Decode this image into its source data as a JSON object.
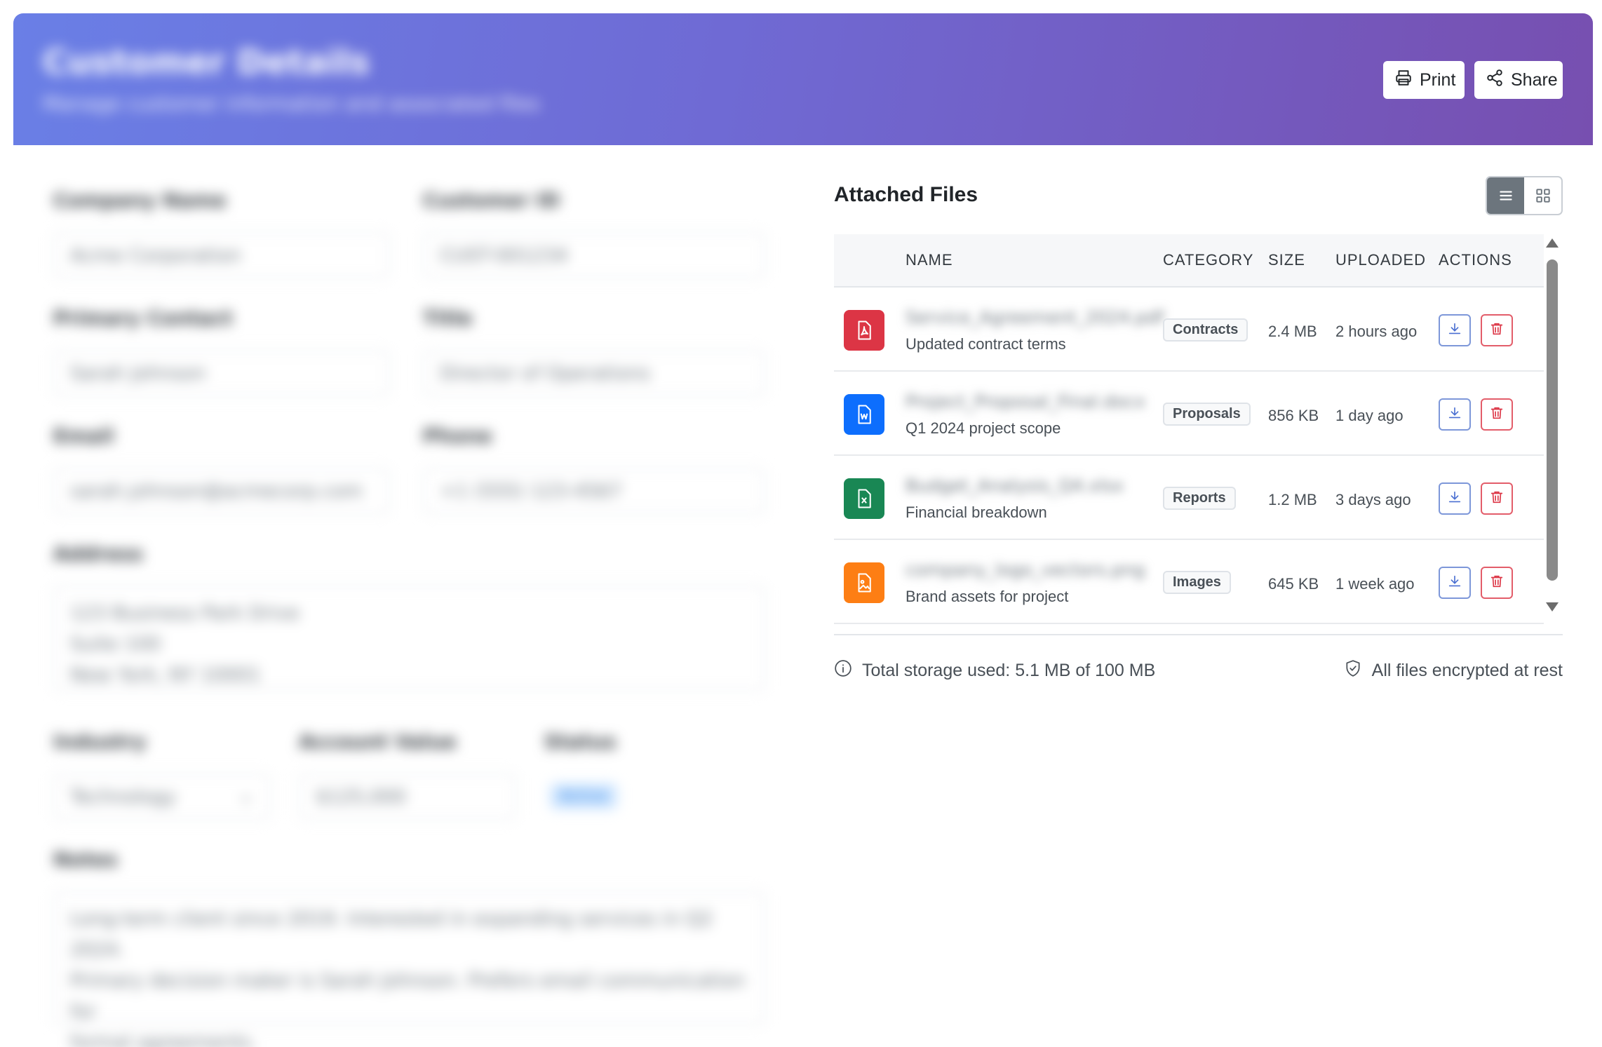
{
  "header": {
    "title": "Customer Details",
    "subtitle": "Manage customer information and associated files",
    "print_label": "Print",
    "share_label": "Share"
  },
  "form": {
    "company_name": {
      "label": "Company Name",
      "value": "Acme Corporation"
    },
    "customer_id": {
      "label": "Customer ID",
      "value": "CUST-001234"
    },
    "primary_contact": {
      "label": "Primary Contact",
      "value": "Sarah Johnson"
    },
    "title": {
      "label": "Title",
      "value": "Director of Operations"
    },
    "email": {
      "label": "Email",
      "value": "sarah.johnson@acmecorp.com"
    },
    "phone": {
      "label": "Phone",
      "value": "+1 (555) 123-4567"
    },
    "address": {
      "label": "Address",
      "lines": [
        "123 Business Park Drive",
        "Suite 100",
        "New York, NY 10001"
      ]
    },
    "industry": {
      "label": "Industry",
      "value": "Technology"
    },
    "account_value": {
      "label": "Account Value",
      "value": "$125,000"
    },
    "status": {
      "label": "Status",
      "value": "Active"
    },
    "notes": {
      "label": "Notes",
      "lines": [
        "Long-term client since 2019. Interested in expanding services in Q2 2024.",
        "Primary decision maker is Sarah Johnson. Prefers email communication for",
        "formal agreements."
      ]
    }
  },
  "files": {
    "title": "Attached Files",
    "view": "list",
    "columns": [
      "NAME",
      "CATEGORY",
      "SIZE",
      "UPLOADED",
      "ACTIONS"
    ],
    "rows": [
      {
        "icon": "pdf-file-icon",
        "color": "#dc3545",
        "name": "Service_Agreement_2024.pdf",
        "description": "Updated contract terms",
        "category": "Contracts",
        "size": "2.4 MB",
        "uploaded": "2 hours ago"
      },
      {
        "icon": "word-file-icon",
        "color": "#0d6efd",
        "name": "Project_Proposal_Final.docx",
        "description": "Q1 2024 project scope",
        "category": "Proposals",
        "size": "856 KB",
        "uploaded": "1 day ago"
      },
      {
        "icon": "excel-file-icon",
        "color": "#198754",
        "name": "Budget_Analysis_Q4.xlsx",
        "description": "Financial breakdown",
        "category": "Reports",
        "size": "1.2 MB",
        "uploaded": "3 days ago"
      },
      {
        "icon": "image-file-icon",
        "color": "#fd7e14",
        "name": "company_logo_vectors.png",
        "description": "Brand assets for project",
        "category": "Images",
        "size": "645 KB",
        "uploaded": "1 week ago"
      }
    ],
    "storage_text": "Total storage used: 5.1 MB of 100 MB",
    "encryption_text": "All files encrypted at rest"
  },
  "colors": {
    "header_gradient_start": "#6a7fe6",
    "header_gradient_end": "#774fb0",
    "download_accent": "#7d97d9",
    "delete_accent": "#e35d6a"
  }
}
